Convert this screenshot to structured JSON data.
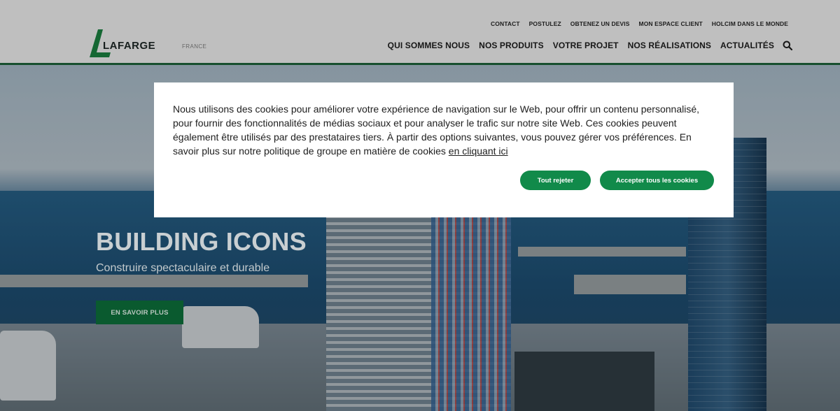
{
  "header": {
    "logo_text": "LAFARGE",
    "country": "FRANCE",
    "utility_nav": [
      "CONTACT",
      "POSTULEZ",
      "OBTENEZ UN DEVIS",
      "MON ESPACE CLIENT",
      "HOLCIM DANS LE MONDE"
    ],
    "main_nav": [
      "QUI SOMMES NOUS",
      "NOS PRODUITS",
      "VOTRE PROJET",
      "NOS RÉALISATIONS",
      "ACTUALITÉS"
    ],
    "search_icon": "search-icon"
  },
  "hero": {
    "title": "BUILDING ICONS",
    "subtitle": "Construire spectaculaire et durable",
    "cta_label": "EN SAVOIR PLUS"
  },
  "cookie_banner": {
    "text": "Nous utilisons des cookies pour améliorer votre expérience de navigation sur le Web, pour offrir un contenu personnalisé, pour fournir des fonctionnalités de médias sociaux et pour analyser le trafic sur notre site Web. Ces cookies peuvent également être utilisés par des prestataires tiers. À partir des options suivantes, vous pouvez gérer vos préférences. En savoir plus sur notre politique de groupe en matière de cookies ",
    "link_text": "en cliquant ici",
    "reject_label": "Tout rejeter",
    "accept_label": "Accepter tous les cookies"
  },
  "colors": {
    "brand_green": "#118a4a",
    "header_rule": "#1f6a3e",
    "hero_button": "#0a5a2f"
  }
}
